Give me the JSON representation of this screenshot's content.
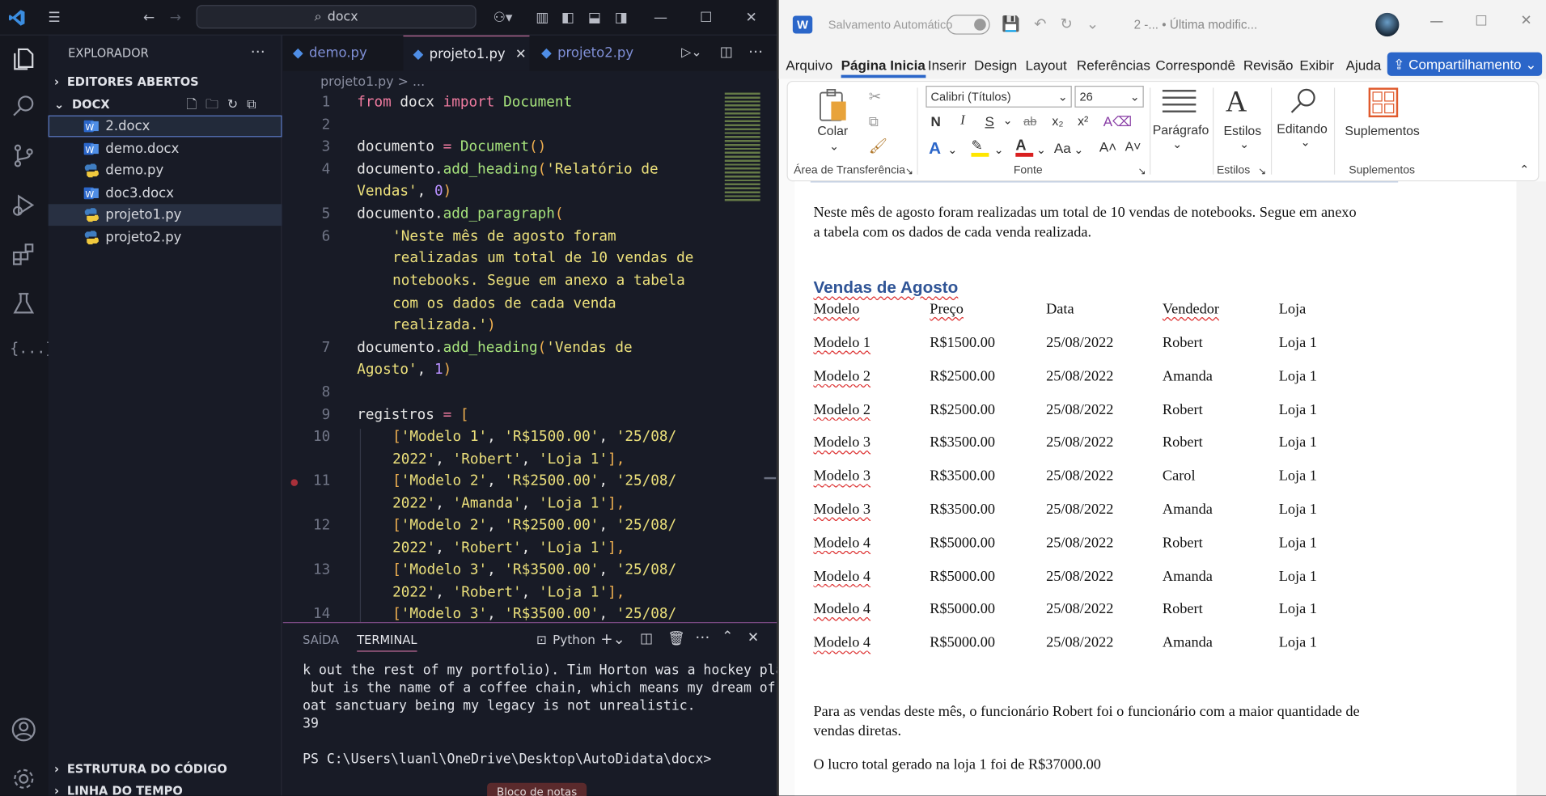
{
  "vscode": {
    "search_text": "docx",
    "explorer_title": "EXPLORADOR",
    "section_open_editors": "EDITORES ABERTOS",
    "section_folder": "DOCX",
    "files": [
      "2.docx",
      "demo.docx",
      "demo.py",
      "doc3.docx",
      "projeto1.py",
      "projeto2.py"
    ],
    "section_outline": "ESTRUTURA DO CÓDIGO",
    "section_timeline": "LINHA DO TEMPO",
    "tabs": [
      "demo.py",
      "projeto1.py",
      "projeto2.py"
    ],
    "breadcrumb": [
      "projeto1.py",
      ">",
      "..."
    ],
    "line_numbers": [
      "1",
      "2",
      "3",
      "4",
      "5",
      "6",
      "7",
      "8",
      "9",
      "10",
      "11",
      "12",
      "13",
      "14"
    ],
    "code": {
      "l1": [
        "from",
        " docx ",
        "import",
        " Document"
      ],
      "l3": [
        "documento",
        " = ",
        "Document",
        "()"
      ],
      "l4a": [
        "documento.",
        "add_heading",
        "(",
        "'Relatório de"
      ],
      "l4b": [
        "Vendas'",
        ", ",
        "0",
        ")"
      ],
      "l5": [
        "documento.",
        "add_paragraph",
        "("
      ],
      "l6a": "'Neste mês de agosto foram",
      "l6b": "realizadas um total de 10 vendas de",
      "l6c": "notebooks. Segue em anexo a tabela",
      "l6d": "com os dados de cada venda",
      "l6e": [
        "realizada.'",
        ")"
      ],
      "l7a": [
        "documento.",
        "add_heading",
        "(",
        "'Vendas de"
      ],
      "l7b": [
        "Agosto'",
        ", ",
        "1",
        ")"
      ],
      "l9": [
        "registros",
        " = ",
        "["
      ],
      "l10a": [
        "[",
        "'Modelo 1'",
        ", ",
        "'R$1500.00'",
        ", ",
        "'25/08/"
      ],
      "l10b": [
        "2022'",
        ", ",
        "'Robert'",
        ", ",
        "'Loja 1'",
        "],"
      ],
      "l11a": [
        "[",
        "'Modelo 2'",
        ", ",
        "'R$2500.00'",
        ", ",
        "'25/08/"
      ],
      "l11b": [
        "2022'",
        ", ",
        "'Amanda'",
        ", ",
        "'Loja 1'",
        "],"
      ],
      "l12a": [
        "[",
        "'Modelo 2'",
        ", ",
        "'R$2500.00'",
        ", ",
        "'25/08/"
      ],
      "l12b": [
        "2022'",
        ", ",
        "'Robert'",
        ", ",
        "'Loja 1'",
        "],"
      ],
      "l13a": [
        "[",
        "'Modelo 3'",
        ", ",
        "'R$3500.00'",
        ", ",
        "'25/08/"
      ],
      "l13b": [
        "2022'",
        ", ",
        "'Robert'",
        ", ",
        "'Loja 1'",
        "],"
      ],
      "l14a": [
        "[",
        "'Modelo 3'",
        ", ",
        "'R$3500.00'",
        ", ",
        "'25/08/"
      ]
    },
    "panel_tabs": [
      "SAÍDA",
      "TERMINAL"
    ],
    "terminal_profile": "Python",
    "terminal_lines": [
      "k out the rest of my portfolio). Tim Horton was a hockey player",
      " but is the name of a coffee chain, which means my dream of a g",
      "oat sanctuary being my legacy is not unrealistic.",
      "39",
      "",
      "PS C:\\Users\\luanl\\OneDrive\\Desktop\\AutoDidata\\docx>"
    ],
    "toast": "Bloco de notas"
  },
  "word": {
    "autosave": "Salvamento Automático",
    "doc_title": "2 -... • Última modific...",
    "tabs": [
      "Arquivo",
      "Página Inicia",
      "Inserir",
      "Design",
      "Layout",
      "Referências",
      "Correspondê",
      "Revisão",
      "Exibir",
      "Ajuda"
    ],
    "share": "Compartilhamento",
    "font_name": "Calibri (Títulos)",
    "font_size": "26",
    "groups": {
      "clipboard": "Área de Transferência",
      "font": "Fonte",
      "styles": "Estilos",
      "addins": "Suplementos"
    },
    "buttons": {
      "paste": "Colar",
      "paragraph": "Parágrafo",
      "styles": "Estilos",
      "editing": "Editando",
      "addins": "Suplementos"
    },
    "format": {
      "bold": "N",
      "italic": "I",
      "underline": "S",
      "strike": "ab",
      "sub": "x₂",
      "sup": "x²",
      "case": "Aa"
    },
    "intro": [
      "Neste mês de agosto foram realizadas um total de 10 vendas de notebooks. Segue em anexo",
      "a tabela com os dados de cada venda realizada."
    ],
    "heading": "Vendas de Agosto",
    "table_header": [
      "Modelo",
      "Preço",
      "Data",
      "Vendedor",
      "Loja"
    ],
    "rows": [
      [
        "Modelo 1",
        "R$1500.00",
        "25/08/2022",
        "Robert",
        "Loja 1"
      ],
      [
        "Modelo 2",
        "R$2500.00",
        "25/08/2022",
        "Amanda",
        "Loja 1"
      ],
      [
        "Modelo 2",
        "R$2500.00",
        "25/08/2022",
        "Robert",
        "Loja 1"
      ],
      [
        "Modelo 3",
        "R$3500.00",
        "25/08/2022",
        "Robert",
        "Loja 1"
      ],
      [
        "Modelo 3",
        "R$3500.00",
        "25/08/2022",
        "Carol",
        "Loja 1"
      ],
      [
        "Modelo 3",
        "R$3500.00",
        "25/08/2022",
        "Amanda",
        "Loja 1"
      ],
      [
        "Modelo 4",
        "R$5000.00",
        "25/08/2022",
        "Robert",
        "Loja 1"
      ],
      [
        "Modelo 4",
        "R$5000.00",
        "25/08/2022",
        "Amanda",
        "Loja 1"
      ],
      [
        "Modelo 4",
        "R$5000.00",
        "25/08/2022",
        "Robert",
        "Loja 1"
      ],
      [
        "Modelo 4",
        "R$5000.00",
        "25/08/2022",
        "Amanda",
        "Loja 1"
      ]
    ],
    "summary": [
      "Para as vendas deste mês, o funcionário Robert foi o funcionário com a maior quantidade de",
      "vendas diretas."
    ],
    "profit": "O lucro total gerado na loja 1 foi de R$37000.00"
  }
}
